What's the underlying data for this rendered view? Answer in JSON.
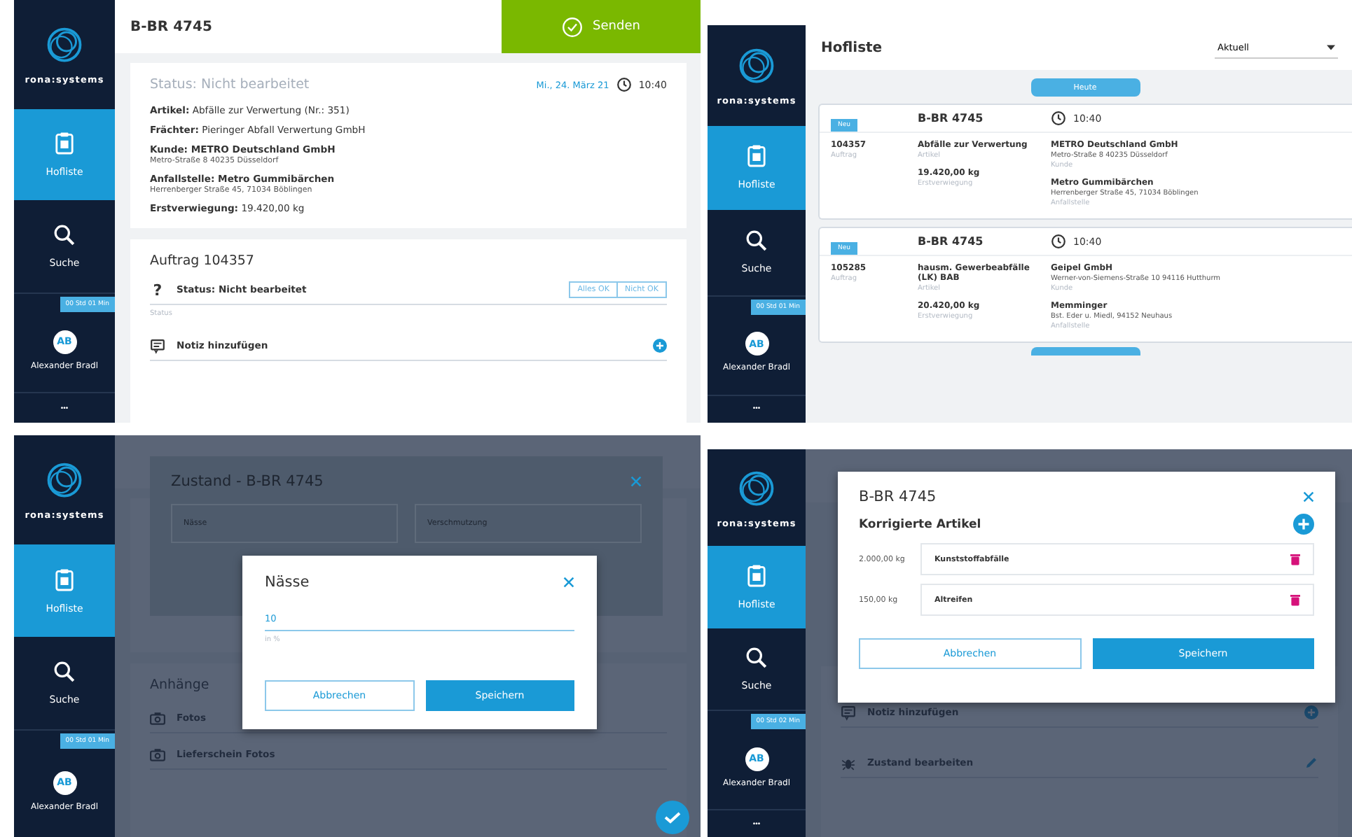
{
  "panels": [
    {
      "kind": "detail",
      "sidebar": {
        "logo_text": "rona:systems",
        "items": [
          {
            "label": "Hofliste",
            "selected": true
          },
          {
            "label": "Suche",
            "selected": false
          }
        ],
        "timer": "00 Std 01 Min",
        "user": {
          "initials": "AB",
          "name": "Alexander Bradl"
        },
        "more": "•••"
      },
      "header": {
        "title": "B-BR 4745",
        "send_button": "Senden"
      },
      "info_card": {
        "status": "Status: Nicht bearbeitet",
        "date": "Mi., 24. März 21",
        "time": "10:40",
        "fields": [
          {
            "text": "**Artikel:** Abfälle zur Verwertung (Nr.: 351)"
          },
          {
            "text": "**Frächter:** Pieringer Abfall Verwertung GmbH"
          },
          {
            "text": "**Kunde: METRO Deutschland GmbH**",
            "address": "Metro-Straße 8 40235 Düsseldorf"
          },
          {
            "text": "**Anfallstelle: Metro Gummibärchen**",
            "address": "Herrenberger Straße 45, 71034 Böblingen"
          },
          {
            "text": "**Erstverwiegung:** 19.420,00 kg"
          }
        ]
      },
      "order_card": {
        "title": "Auftrag 104357",
        "status_row": {
          "icon": "?",
          "text": "Status: Nicht bearbeitet",
          "caption": "Status",
          "buttons": [
            "Alles OK",
            "Nicht OK"
          ]
        },
        "note_row": {
          "text": "Notiz hinzufügen"
        }
      }
    },
    {
      "kind": "list",
      "sidebar": {
        "logo_text": "rona:systems",
        "items": [
          {
            "label": "Hofliste",
            "selected": true
          },
          {
            "label": "Suche",
            "selected": false
          }
        ],
        "timer": "00 Std 01 Min",
        "user": {
          "initials": "AB",
          "name": "Alexander Bradl"
        },
        "more": "•••"
      },
      "header": {
        "title": "Hofliste",
        "dropdown": "Aktuell"
      },
      "day_button": "Heute",
      "cards": [
        {
          "badge": "Neu",
          "plate": "B-BR 4745",
          "time": "10:40",
          "order_no": "104357",
          "order_label": "Auftrag",
          "article": "Abfälle zur Verwertung",
          "article_label": "Artikel",
          "weight": "19.420,00 kg",
          "weight_label": "Erstverwiegung",
          "customer": "METRO Deutschland GmbH",
          "customer_address": "Metro-Straße 8 40235 Düsseldorf",
          "customer_label": "Kunde",
          "site": "Metro Gummibärchen",
          "site_address": "Herrenberger Straße 45, 71034 Böblingen",
          "site_label": "Anfallstelle"
        },
        {
          "badge": "Neu",
          "plate": "B-BR 4745",
          "time": "10:40",
          "order_no": "105285",
          "order_label": "Auftrag",
          "article": "hausm. Gewerbeabfälle (LK) BAB",
          "article_label": "Artikel",
          "weight": "20.420,00 kg",
          "weight_label": "Erstverwiegung",
          "customer": "Geipel GmbH",
          "customer_address": "Werner-von-Siemens-Straße 10 94116 Hutthurm",
          "customer_label": "Kunde",
          "site": "Memminger",
          "site_address": "Bst. Eder u. Miedl, 94152 Neuhaus",
          "site_label": "Anfallstelle"
        }
      ]
    },
    {
      "kind": "nested_dialog",
      "sidebar": {
        "logo_text": "rona:systems",
        "items": [
          {
            "label": "Hofliste",
            "selected": true
          },
          {
            "label": "Suche",
            "selected": false
          }
        ],
        "timer": "00 Std 01 Min",
        "user": {
          "initials": "AB",
          "name": "Alexander Bradl"
        }
      },
      "background": {
        "section": "Anhänge",
        "rows": [
          "Fotos",
          "Lieferschein Fotos"
        ]
      },
      "outer_dialog": {
        "title": "Zustand - B-BR 4745",
        "fields": [
          "Nässe",
          "Verschmutzung"
        ]
      },
      "dialog": {
        "title": "Nässe",
        "value": "10",
        "hint": "in %",
        "buttons": [
          "Abbrechen",
          "Speichern"
        ]
      }
    },
    {
      "kind": "articles_dialog",
      "sidebar": {
        "logo_text": "rona:systems",
        "items": [
          {
            "label": "Hofliste",
            "selected": true
          },
          {
            "label": "Suche",
            "selected": false
          }
        ],
        "timer": "00 Std 02 Min",
        "user": {
          "initials": "AB",
          "name": "Alexander Bradl"
        },
        "more": "•••"
      },
      "background": {
        "rows": [
          "Notiz hinzufügen",
          "Zustand bearbeiten"
        ]
      },
      "dialog": {
        "title": "B-BR 4745",
        "section": "Korrigierte Artikel",
        "items": [
          {
            "weight": "2.000,00 kg",
            "name": "Kunststoffabfälle"
          },
          {
            "weight": "150,00 kg",
            "name": "Altreifen"
          }
        ],
        "buttons": [
          "Abbrechen",
          "Speichern"
        ]
      }
    }
  ]
}
